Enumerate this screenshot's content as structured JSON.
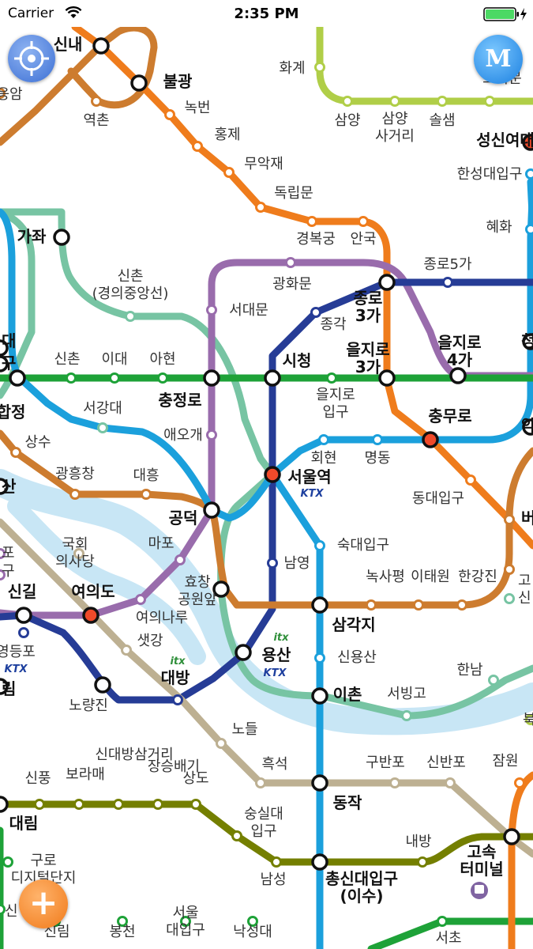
{
  "status_bar": {
    "carrier": "Carrier",
    "time": "2:35 PM"
  },
  "colors": {
    "line1": "#263c96",
    "line2": "#1ea238",
    "line3": "#ef7c1c",
    "line4": "#1ba0dc",
    "line5": "#996cac",
    "line6": "#cd7c2f",
    "line7": "#747f00",
    "line8": "#e6186c",
    "line9": "#bdb092",
    "airport": "#0090d2",
    "gyeongui": "#77c4a3",
    "ui": "#b0ce48",
    "sinbundang": "#d4003b",
    "river": "#c8e6f5"
  },
  "buttons": {
    "menu": "M",
    "zoom_in": "+"
  },
  "stations": [
    {
      "name": "신내",
      "line": "line6",
      "type": "transfer"
    },
    {
      "name": "불광",
      "line": "line3",
      "type": "transfer"
    },
    {
      "name": "응암",
      "line": "line6",
      "type": "stop"
    },
    {
      "name": "역촌",
      "line": "line6",
      "type": "stop"
    },
    {
      "name": "녹번",
      "line": "line3",
      "type": "stop"
    },
    {
      "name": "홍제",
      "line": "line3",
      "type": "stop"
    },
    {
      "name": "무악재",
      "line": "line3",
      "type": "stop"
    },
    {
      "name": "독립문",
      "line": "line3",
      "type": "stop"
    },
    {
      "name": "경복궁",
      "line": "line3",
      "type": "stop"
    },
    {
      "name": "안국",
      "line": "line3",
      "type": "stop"
    },
    {
      "name": "화계",
      "line": "ui",
      "type": "stop"
    },
    {
      "name": "삼양",
      "line": "ui",
      "type": "stop"
    },
    {
      "name": "삼양\n사거리",
      "line": "ui",
      "type": "stop"
    },
    {
      "name": "솔샘",
      "line": "ui",
      "type": "stop"
    },
    {
      "name": "보국문",
      "line": "ui",
      "type": "stop"
    },
    {
      "name": "성신여대",
      "line": "line4",
      "type": "transfer"
    },
    {
      "name": "한성대입구",
      "line": "line4",
      "type": "stop"
    },
    {
      "name": "혜화",
      "line": "line4",
      "type": "stop"
    },
    {
      "name": "가좌",
      "line": "gyeongui",
      "type": "transfer"
    },
    {
      "name": "신촌\n(경의중앙선)",
      "line": "gyeongui",
      "type": "stop"
    },
    {
      "name": "광화문",
      "line": "line5",
      "type": "stop"
    },
    {
      "name": "서대문",
      "line": "line5",
      "type": "stop"
    },
    {
      "name": "종로5가",
      "line": "line1",
      "type": "stop"
    },
    {
      "name": "종로\n3가",
      "line": "line1",
      "type": "transfer"
    },
    {
      "name": "종각",
      "line": "line1",
      "type": "stop"
    },
    {
      "name": "을지로\n4가",
      "line": "line2",
      "type": "transfer"
    },
    {
      "name": "을지로\n3가",
      "line": "line2",
      "type": "transfer"
    },
    {
      "name": "시청",
      "line": "line2",
      "type": "transfer"
    },
    {
      "name": "신촌",
      "line": "line2",
      "type": "stop"
    },
    {
      "name": "이대",
      "line": "line2",
      "type": "stop"
    },
    {
      "name": "아현",
      "line": "line2",
      "type": "stop"
    },
    {
      "name": "충정로",
      "line": "line2",
      "type": "transfer"
    },
    {
      "name": "을지로\n입구",
      "line": "line2",
      "type": "stop"
    },
    {
      "name": "충무로",
      "line": "line4",
      "type": "transfer"
    },
    {
      "name": "서강대",
      "line": "gyeongui",
      "type": "stop"
    },
    {
      "name": "애오개",
      "line": "line5",
      "type": "stop"
    },
    {
      "name": "회현",
      "line": "line4",
      "type": "stop"
    },
    {
      "name": "명동",
      "line": "line4",
      "type": "stop"
    },
    {
      "name": "합정",
      "line": "line2",
      "type": "transfer"
    },
    {
      "name": "상수",
      "line": "line6",
      "type": "stop"
    },
    {
      "name": "광흥창",
      "line": "line6",
      "type": "stop"
    },
    {
      "name": "대흥",
      "line": "line6",
      "type": "stop"
    },
    {
      "name": "서울역",
      "line": "line1",
      "type": "transfer"
    },
    {
      "name": "동대입구",
      "line": "line3",
      "type": "stop"
    },
    {
      "name": "공덕",
      "line": "line5",
      "type": "transfer"
    },
    {
      "name": "국회\n의사당",
      "line": "line9",
      "type": "stop"
    },
    {
      "name": "마포",
      "line": "line5",
      "type": "stop"
    },
    {
      "name": "남영",
      "line": "line1",
      "type": "stop"
    },
    {
      "name": "숙대입구",
      "line": "line4",
      "type": "stop"
    },
    {
      "name": "효창\n공원앞",
      "line": "line6",
      "type": "transfer"
    },
    {
      "name": "녹사평",
      "line": "line6",
      "type": "stop"
    },
    {
      "name": "이태원",
      "line": "line6",
      "type": "stop"
    },
    {
      "name": "한강진",
      "line": "line6",
      "type": "stop"
    },
    {
      "name": "신길",
      "line": "line5",
      "type": "transfer"
    },
    {
      "name": "여의도",
      "line": "line5",
      "type": "transfer"
    },
    {
      "name": "여의나루",
      "line": "line5",
      "type": "stop"
    },
    {
      "name": "삼각지",
      "line": "line4",
      "type": "transfer"
    },
    {
      "name": "샛강",
      "line": "line9",
      "type": "stop"
    },
    {
      "name": "영등포",
      "line": "line1",
      "type": "stop"
    },
    {
      "name": "용산",
      "line": "line1",
      "type": "transfer"
    },
    {
      "name": "신용산",
      "line": "line4",
      "type": "stop"
    },
    {
      "name": "한남",
      "line": "gyeongui",
      "type": "stop"
    },
    {
      "name": "노량진",
      "line": "line1",
      "type": "transfer"
    },
    {
      "name": "대방",
      "line": "line1",
      "type": "stop"
    },
    {
      "name": "이촌",
      "line": "line4",
      "type": "transfer"
    },
    {
      "name": "서빙고",
      "line": "gyeongui",
      "type": "stop"
    },
    {
      "name": "노들",
      "line": "line9",
      "type": "stop"
    },
    {
      "name": "흑석",
      "line": "line9",
      "type": "stop"
    },
    {
      "name": "구반포",
      "line": "line9",
      "type": "stop"
    },
    {
      "name": "신반포",
      "line": "line9",
      "type": "stop"
    },
    {
      "name": "잠원",
      "line": "line3",
      "type": "stop"
    },
    {
      "name": "동작",
      "line": "line4",
      "type": "transfer"
    },
    {
      "name": "신풍",
      "line": "line7",
      "type": "stop"
    },
    {
      "name": "보라매",
      "line": "line7",
      "type": "stop"
    },
    {
      "name": "신대방삼거리",
      "line": "line7",
      "type": "stop"
    },
    {
      "name": "장승배기",
      "line": "line7",
      "type": "stop"
    },
    {
      "name": "상도",
      "line": "line7",
      "type": "stop"
    },
    {
      "name": "대림",
      "line": "line7",
      "type": "transfer"
    },
    {
      "name": "숭실대\n입구",
      "line": "line7",
      "type": "stop"
    },
    {
      "name": "내방",
      "line": "line7",
      "type": "stop"
    },
    {
      "name": "구로\n디지털단지",
      "line": "line2",
      "type": "stop"
    },
    {
      "name": "남성",
      "line": "line7",
      "type": "stop"
    },
    {
      "name": "총신대입구\n(이수)",
      "line": "line4",
      "type": "transfer"
    },
    {
      "name": "고속\n터미널",
      "line": "line3",
      "type": "transfer"
    },
    {
      "name": "신림",
      "line": "line2",
      "type": "stop"
    },
    {
      "name": "봉천",
      "line": "line2",
      "type": "stop"
    },
    {
      "name": "서울\n대입구",
      "line": "line2",
      "type": "stop"
    },
    {
      "name": "낙성대",
      "line": "line2",
      "type": "stop"
    },
    {
      "name": "서초",
      "line": "line2",
      "type": "stop"
    },
    {
      "name": "대",
      "line": "line2",
      "type": "transfer"
    },
    {
      "name": "구",
      "line": "line2",
      "type": "transfer"
    },
    {
      "name": "산",
      "line": "line6",
      "type": "transfer"
    },
    {
      "name": "포",
      "line": "line5",
      "type": "stop"
    },
    {
      "name": "구",
      "line": "line5",
      "type": "stop"
    },
    {
      "name": "림",
      "line": "line1",
      "type": "transfer"
    },
    {
      "name": "신",
      "line": "line2",
      "type": "stop"
    },
    {
      "name": "청",
      "line": "line2",
      "type": "transfer"
    },
    {
      "name": "약",
      "line": "line6",
      "type": "transfer"
    },
    {
      "name": "버",
      "line": "line6",
      "type": "stop"
    },
    {
      "name": "고",
      "line": "line6",
      "type": "stop"
    },
    {
      "name": "신",
      "line": "gyeongui",
      "type": "stop"
    },
    {
      "name": "북",
      "line": "ui",
      "type": "stop"
    }
  ],
  "badges": {
    "ktx": "KTX",
    "itx": "itx"
  }
}
